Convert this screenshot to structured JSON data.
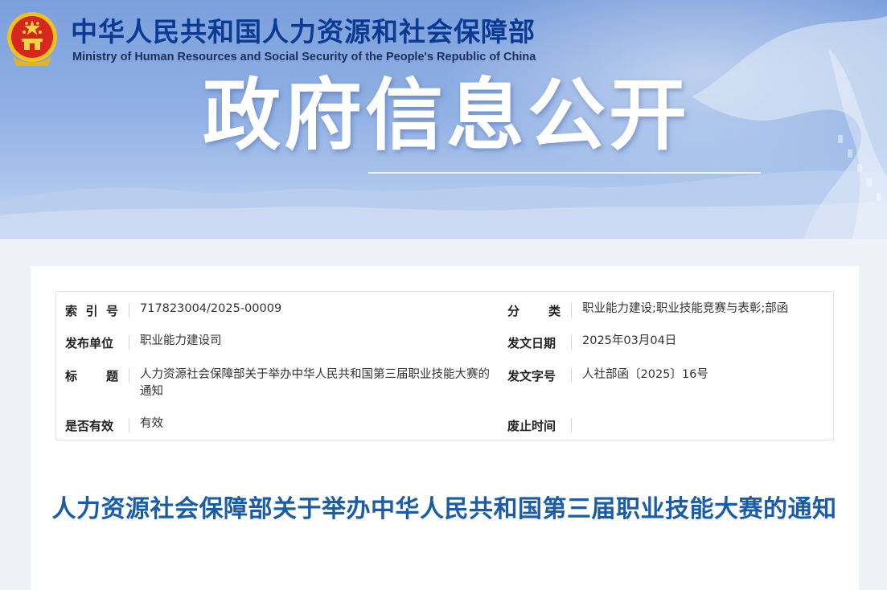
{
  "header": {
    "ministry_cn": "中华人民共和国人力资源和社会保障部",
    "ministry_en": "Ministry of Human Resources and Social Security of the People's Republic of China",
    "banner_title": "政府信息公开"
  },
  "meta": {
    "index_no": {
      "label_chars": [
        "索",
        "引",
        "号"
      ],
      "value": "717823004/2025-00009"
    },
    "category": {
      "label_chars": [
        "分",
        "类"
      ],
      "value": "职业能力建设;职业技能竞赛与表彰;部函"
    },
    "issuer": {
      "label": "发布单位",
      "value": "职业能力建设司"
    },
    "issue_date": {
      "label": "发文日期",
      "value": "2025年03月04日"
    },
    "title": {
      "label_chars": [
        "标",
        "题"
      ],
      "value": "人力资源社会保障部关于举办中华人民共和国第三届职业技能大赛的通知"
    },
    "doc_number": {
      "label": "发文字号",
      "value": "人社部函〔2025〕16号"
    },
    "validity": {
      "label": "是否有效",
      "value": "有效"
    },
    "repeal_date": {
      "label": "废止时间",
      "value": ""
    }
  },
  "document": {
    "title": "人力资源社会保障部关于举办中华人民共和国第三届职业技能大赛的通知"
  },
  "colors": {
    "ministry_text": "#0b3a93",
    "doc_title": "#1a5ca8",
    "banner_top": "#7b9fdc"
  }
}
